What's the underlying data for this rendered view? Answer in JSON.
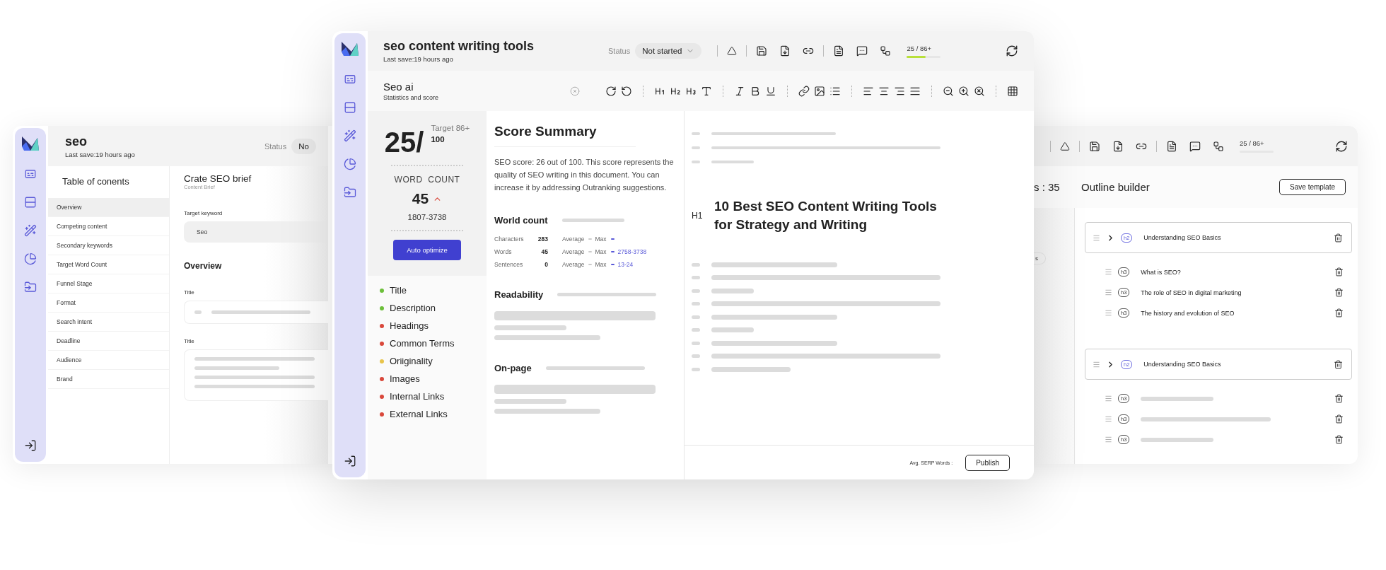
{
  "back_window": {
    "title": "seo",
    "last_save": "Last save:19 hours ago",
    "status_label": "Status",
    "status_value": "No",
    "toc_title": "Table of conents",
    "toc": [
      {
        "label": "Overview",
        "selected": true
      },
      {
        "label": "Competing content",
        "selected": false
      },
      {
        "label": "Secondary keywords",
        "selected": false
      },
      {
        "label": "Target Word Count",
        "selected": false
      },
      {
        "label": "Funnel Stage",
        "selected": false
      },
      {
        "label": "Format",
        "selected": false
      },
      {
        "label": "Search intent",
        "selected": false
      },
      {
        "label": "Deadline",
        "selected": false
      },
      {
        "label": "Audience",
        "selected": false
      },
      {
        "label": "Brand",
        "selected": false
      }
    ],
    "brief_title": "Crate SEO brief",
    "brief_subtitle": "Content Brief",
    "keyword_label": "Target keyword",
    "keyword_value": "Seo",
    "overview_title": "Overview",
    "fields": [
      {
        "label": "Title",
        "kind": "line"
      },
      {
        "label": "Title",
        "kind": "area"
      }
    ],
    "score_text": "25 / 86+",
    "headings_count": "s : 35",
    "chip": "s",
    "outline_title": "Outline builder",
    "save_template": "Save template",
    "outline": [
      {
        "tag": "h2",
        "text": "Understanding SEO Basics",
        "children": [
          {
            "tag": "h3",
            "text": "What is SEO?"
          },
          {
            "tag": "h3",
            "text": "The role of SEO in digital marketing"
          },
          {
            "tag": "h3",
            "text": "The history and evolution of SEO"
          }
        ]
      },
      {
        "tag": "h2",
        "text": "Understanding SEO Basics",
        "children": [
          {
            "tag": "h3"
          },
          {
            "tag": "h3"
          },
          {
            "tag": "h3"
          }
        ]
      }
    ]
  },
  "front_window": {
    "title": "seo content writing tools",
    "last_save": "Last save:19 hours ago",
    "status_label": "Status",
    "status_value": "Not started",
    "score_meter": {
      "text": "25 / 86+",
      "level": 0.55
    },
    "panel": {
      "title": "Seo ai",
      "subtitle": "Statistics and score"
    },
    "score": {
      "value": "25/",
      "target": "Target 86+",
      "max": "100",
      "word_count_label": "WORD  COUNT",
      "word_count": "45",
      "range": "1807-3738",
      "button": "Auto optimize"
    },
    "checks": [
      {
        "label": "Title",
        "color": "#6cbf3a"
      },
      {
        "label": "Description",
        "color": "#6cbf3a"
      },
      {
        "label": "Headings",
        "color": "#d9483b"
      },
      {
        "label": "Common Terms",
        "color": "#d9483b"
      },
      {
        "label": "Oriiginality",
        "color": "#e8c44a"
      },
      {
        "label": "Images",
        "color": "#d9483b"
      },
      {
        "label": "Internal Links",
        "color": "#d9483b"
      },
      {
        "label": "External Links",
        "color": "#d9483b"
      }
    ],
    "summary": {
      "title": "Score Summary",
      "text": "SEO score: 26 out of 100. This score represents the quality of SEO writing in this document. You can increase it by addressing Outranking suggestions.",
      "world_count_title": "World count",
      "stats": [
        {
          "label": "Characters",
          "value": "283",
          "average": "Average",
          "max": "Max"
        },
        {
          "label": "Words",
          "value": "45",
          "average": "Average",
          "max": "Max",
          "range": "2758-3738"
        },
        {
          "label": "Sentences",
          "value": "0",
          "average": "Average",
          "max": "Max",
          "range": "13-24"
        }
      ],
      "readability_title": "Readability",
      "onpage_title": "On-page"
    },
    "editor": {
      "heading_tag": "H1",
      "heading": "10 Best SEO Content Writing Tools for Strategy and Writing",
      "footer_label": "Avg. SERP Words :",
      "publish": "Publish"
    }
  }
}
